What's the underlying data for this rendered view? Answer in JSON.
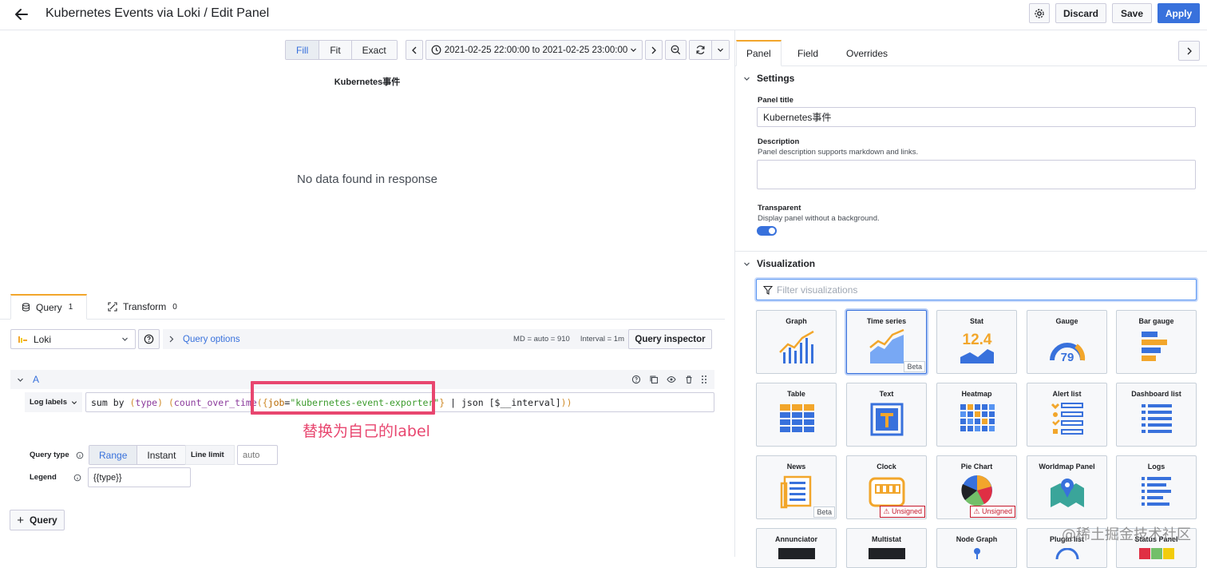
{
  "header": {
    "title": "Kubernetes Events via Loki / Edit Panel",
    "discard_label": "Discard",
    "save_label": "Save",
    "apply_label": "Apply"
  },
  "toolbar": {
    "fill": "Fill",
    "fit": "Fit",
    "exact": "Exact",
    "time_range": "2021-02-25 22:00:00 to 2021-02-25 23:00:00"
  },
  "panel": {
    "title": "Kubernetes事件",
    "no_data": "No data found in response"
  },
  "query_tabs": [
    {
      "label": "Query",
      "count": "1"
    },
    {
      "label": "Transform",
      "count": "0"
    }
  ],
  "query_editor": {
    "datasource": "Loki",
    "query_options": "Query options",
    "stats": "MD = auto = 910",
    "interval": "Interval = 1m",
    "inspector": "Query inspector",
    "ref_id": "A",
    "log_labels": "Log labels",
    "query_parts": {
      "p1": "sum by ",
      "p2": "(",
      "p3": "type",
      "p4": ") ",
      "p5": "(",
      "p6": "count_over_time",
      "p7": "(",
      "p8": "{",
      "p9": "job",
      "p10": "=",
      "p11": "\"kubernetes-event-exporter\"",
      "p12": "}",
      "p13": " | json [$__interval]",
      "p14": "))"
    },
    "query_type_label": "Query type",
    "range": "Range",
    "instant": "Instant",
    "line_limit_label": "Line limit",
    "line_limit_placeholder": "auto",
    "legend_label": "Legend",
    "legend_value": "{{type}}",
    "add_query": "Query"
  },
  "annotation": "替换为自己的label",
  "options": {
    "tabs": [
      "Panel",
      "Field",
      "Overrides"
    ],
    "settings_label": "Settings",
    "panel_title_label": "Panel title",
    "panel_title_value": "Kubernetes事件",
    "description_label": "Description",
    "description_hint": "Panel description supports markdown and links.",
    "transparent_label": "Transparent",
    "transparent_hint": "Display panel without a background.",
    "visualization_label": "Visualization",
    "filter_placeholder": "Filter visualizations"
  },
  "visualizations": [
    {
      "name": "Graph",
      "icon": "graph-icon",
      "badge": ""
    },
    {
      "name": "Time series",
      "icon": "time-series-icon",
      "badge": "Beta"
    },
    {
      "name": "Stat",
      "icon": "stat-icon",
      "badge": ""
    },
    {
      "name": "Gauge",
      "icon": "gauge-icon",
      "badge": ""
    },
    {
      "name": "Bar gauge",
      "icon": "bar-gauge-icon",
      "badge": ""
    },
    {
      "name": "Table",
      "icon": "table-icon",
      "badge": ""
    },
    {
      "name": "Text",
      "icon": "text-icon",
      "badge": ""
    },
    {
      "name": "Heatmap",
      "icon": "heatmap-icon",
      "badge": ""
    },
    {
      "name": "Alert list",
      "icon": "alert-list-icon",
      "badge": ""
    },
    {
      "name": "Dashboard list",
      "icon": "dashboard-list-icon",
      "badge": ""
    },
    {
      "name": "News",
      "icon": "news-icon",
      "badge": "Beta"
    },
    {
      "name": "Clock",
      "icon": "clock-icon",
      "badge": "Unsigned"
    },
    {
      "name": "Pie Chart",
      "icon": "pie-chart-icon",
      "badge": "Unsigned"
    },
    {
      "name": "Worldmap Panel",
      "icon": "worldmap-icon",
      "badge": ""
    },
    {
      "name": "Logs",
      "icon": "logs-icon",
      "badge": ""
    },
    {
      "name": "Annunciator",
      "icon": "annunciator-icon",
      "badge": ""
    },
    {
      "name": "Multistat",
      "icon": "multistat-icon",
      "badge": ""
    },
    {
      "name": "Node Graph",
      "icon": "node-graph-icon",
      "badge": ""
    },
    {
      "name": "Plugin list",
      "icon": "plugin-list-icon",
      "badge": ""
    },
    {
      "name": "Status Panel",
      "icon": "status-panel-icon",
      "badge": ""
    }
  ],
  "stat_value": "12.4",
  "gauge_value": "79",
  "watermark": "@稀土掘金技术社区",
  "colors": {
    "accent": "#3871dc",
    "tab_active": "#f2a62b",
    "highlight": "#e8466f"
  }
}
